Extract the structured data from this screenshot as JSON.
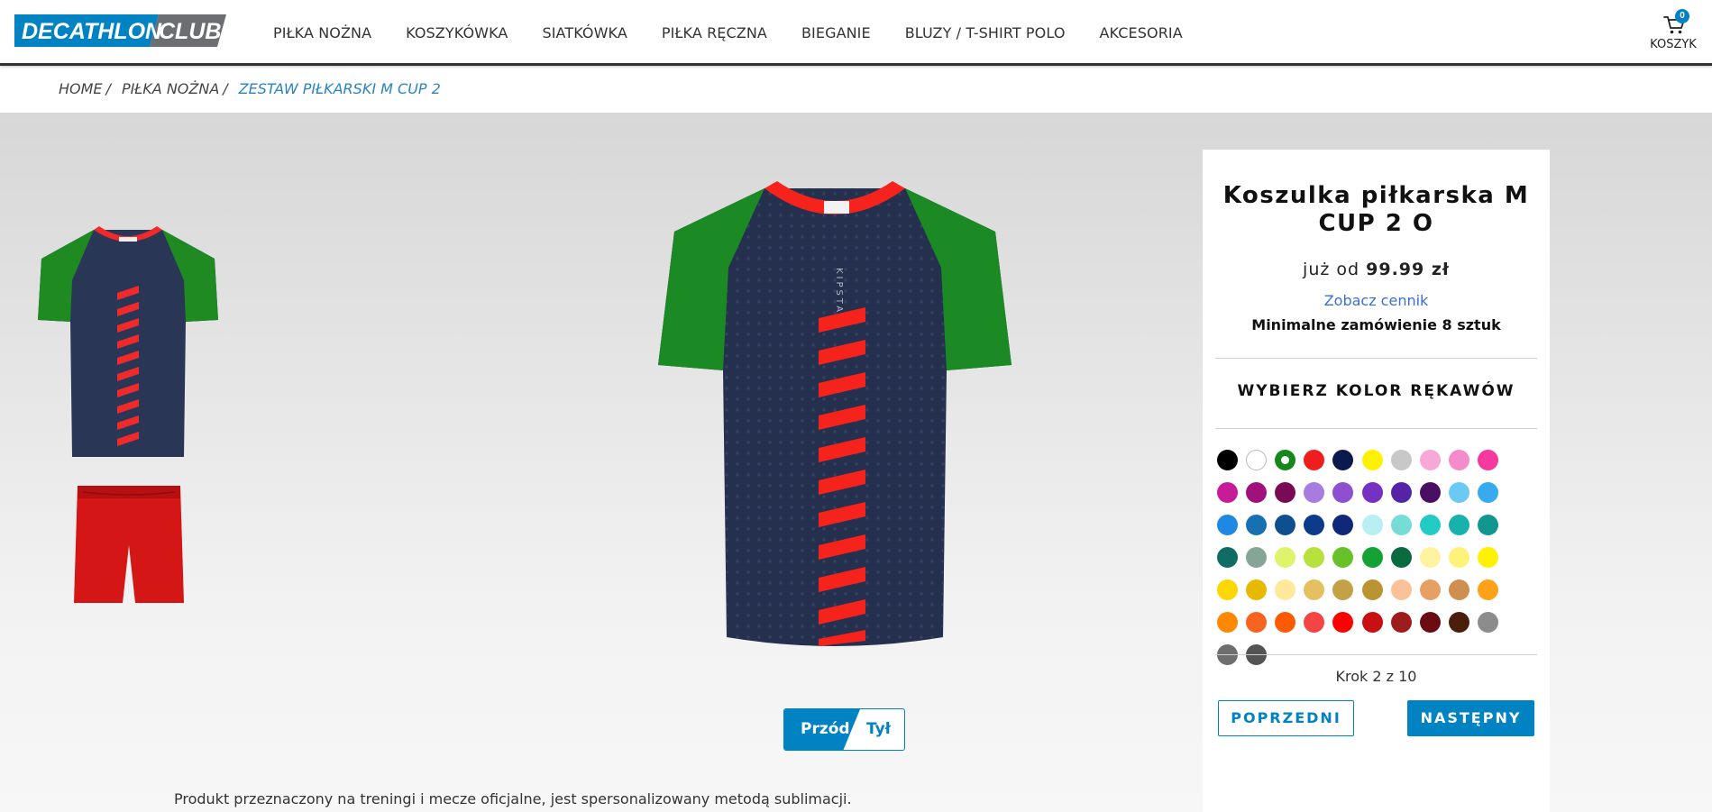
{
  "header": {
    "logo_text": "DECATHLON",
    "logo_club": "CLUB",
    "nav": [
      {
        "label": "PIŁKA NOŻNA"
      },
      {
        "label": "KOSZYKÓWKA"
      },
      {
        "label": "SIATKÓWKA"
      },
      {
        "label": "PIŁKA RĘCZNA"
      },
      {
        "label": "BIEGANIE"
      },
      {
        "label": "BLUZY / T-SHIRT POLO"
      },
      {
        "label": "AKCESORIA"
      }
    ],
    "cart": {
      "label": "KOSZYK",
      "count": "0",
      "icon": "cart-icon"
    }
  },
  "breadcrumb": {
    "items": [
      "HOME",
      "PIŁKA NOŻNA",
      "ZESTAW PIŁKARSKI M CUP 2"
    ],
    "separator": "/"
  },
  "product": {
    "brand_print": "KIPSTA",
    "view_toggle": {
      "front": "Przód",
      "back": "Tył"
    },
    "description": "Produkt przeznaczony na treningi i mecze oficjalne, jest spersonalizowany metodą sublimacji."
  },
  "panel": {
    "title": "Koszulka piłkarska M CUP 2 O",
    "price_prefix": "już od",
    "price": "99.99 zł",
    "pricelist_link": "Zobacz cennik",
    "min_order": "Minimalne zamówienie 8 sztuk",
    "section_title": "WYBIERZ KOLOR RĘKAWÓW",
    "step": "Krok 2 z 10",
    "prev_button": "POPRZEDNI",
    "next_button": "NASTĘPNY",
    "selected_color_index": 2,
    "colors": [
      "#000000",
      "#ffffff",
      "#15881c",
      "#f01d1d",
      "#0b1a4d",
      "#fff200",
      "#c8c8c8",
      "#f7a8d8",
      "#f48bcb",
      "#f5399f",
      "#c71c9a",
      "#a1117c",
      "#7a0a55",
      "#a77be0",
      "#8f4fd1",
      "#7630c2",
      "#5424a7",
      "#4a0e63",
      "#6cc8f5",
      "#38aaf0",
      "#1e88e5",
      "#1770b2",
      "#0e4f8f",
      "#0b3b8a",
      "#10287a",
      "#b8eff2",
      "#75dcd6",
      "#22cbc4",
      "#18b1ad",
      "#129690",
      "#0f6d63",
      "#86a596",
      "#dff46a",
      "#b7e23d",
      "#67c22a",
      "#16a135",
      "#0a6b3f",
      "#fff3a0",
      "#fff27a",
      "#fff200",
      "#ffd700",
      "#e7b900",
      "#ffe89a",
      "#e4c060",
      "#c4a046",
      "#ba9333",
      "#fcc199",
      "#e7a064",
      "#cf8f4e",
      "#ffa21a",
      "#ff8800",
      "#f7641f",
      "#ff5a00",
      "#f44444",
      "#ff0000",
      "#c80f12",
      "#9d1c1c",
      "#6b0c10",
      "#4a1e0a",
      "#8c8c8c",
      "#6e6e6e",
      "#545454"
    ]
  }
}
